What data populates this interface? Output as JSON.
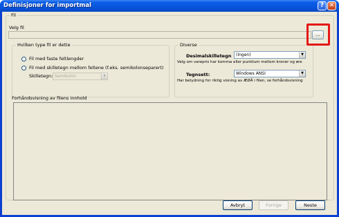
{
  "window": {
    "title": "Definisjoner for importmal",
    "help_glyph": "?",
    "close_glyph": "✕"
  },
  "file": {
    "group_label": "Fil",
    "choose_label": "Velg fil",
    "path_value": "",
    "browse_label": "..."
  },
  "file_type": {
    "group_label": "Hvilken type fil er dette",
    "option_fixed": "Fil med faste feltlengder",
    "option_separated": "Fil med skilletegn mellom feltene (f.eks. semikolonseparert)",
    "separator_label": "Skilletegn:",
    "separator_value": "Semikolon"
  },
  "misc": {
    "group_label": "Diverse",
    "decimal_label": "Desimalskilletegn",
    "decimal_value": "(Ingen)",
    "decimal_desc": "Velg om varepris har komma eller punktum mellom kroner og øre",
    "charset_label": "Tegnsett:",
    "charset_value": "Windows ANSI",
    "charset_desc": "Har betydning for riktig visning av ÆØÅ i filen, se forhåndsvisning"
  },
  "preview": {
    "label": "Forhåndsvisning av filens innhold"
  },
  "buttons": {
    "cancel": "Avbryt",
    "prev": "Forrige",
    "next": "Neste"
  },
  "icons": {
    "dropdown": "▼"
  },
  "colors": {
    "titlebar": "#0855dd",
    "dialog_bg": "#ece9d8",
    "highlight": "#e41616"
  }
}
